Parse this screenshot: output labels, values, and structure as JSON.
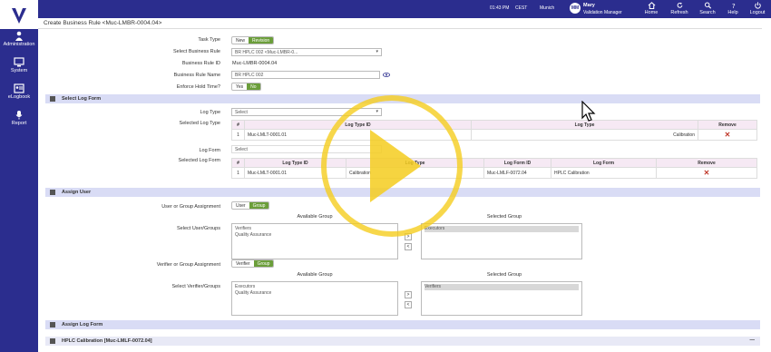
{
  "topbar": {
    "time": "01:43 PM",
    "tz": "CEST",
    "city": "Munich",
    "user_initials": "MM",
    "user_name": "Mary",
    "user_role": "Validation Manager",
    "nav": [
      {
        "label": "Home",
        "icon": "home-icon"
      },
      {
        "label": "Refresh",
        "icon": "refresh-icon"
      },
      {
        "label": "Search",
        "icon": "search-icon"
      },
      {
        "label": "Help",
        "icon": "help-icon"
      },
      {
        "label": "Logout",
        "icon": "power-icon"
      }
    ]
  },
  "sidebar": {
    "items": [
      {
        "label": "Administration",
        "icon": "admin-icon"
      },
      {
        "label": "System",
        "icon": "monitor-icon"
      },
      {
        "label": "eLogbook",
        "icon": "logbook-icon"
      },
      {
        "label": "Report",
        "icon": "report-icon"
      }
    ]
  },
  "page": {
    "title": "Create Business Rule <Muc-LMBR-0004.04>"
  },
  "form": {
    "task_type_label": "Task Type",
    "task_type_opts": [
      "New",
      "Revision"
    ],
    "select_rule_label": "Select Business Rule",
    "select_rule_value": "BR HPLC 002 <Muc-LMBR-0...",
    "rule_id_label": "Business Rule ID",
    "rule_id_value": "Muc-LMBR-0004.04",
    "rule_name_label": "Business Rule Name",
    "rule_name_value": "BR HPLC 002",
    "hold_label": "Enforce Hold Time?",
    "hold_opts": [
      "Yes",
      "No"
    ]
  },
  "log_form_section": {
    "title": "Select Log Form",
    "log_type_label": "Log Type",
    "log_type_value": "Select",
    "sel_log_type_label": "Selected Log Type",
    "lt_headers": [
      "#",
      "Log Type ID",
      "Log Type",
      "Remove"
    ],
    "lt_rows": [
      [
        "1",
        "Muc-LMLT-0001.01",
        "Calibration"
      ]
    ],
    "log_form_label": "Log Form",
    "log_form_value": "Select",
    "sel_log_form_label": "Selected Log Form",
    "lf_headers": [
      "#",
      "Log Type ID",
      "Log Type",
      "Log Form ID",
      "Log Form",
      "Remove"
    ],
    "lf_rows": [
      [
        "1",
        "Muc-LMLT-0001.01",
        "Calibration",
        "Muc-LMLF-0072.04",
        "HPLC Calibration"
      ]
    ]
  },
  "assign_user": {
    "title": "Assign User",
    "ug_label": "User or Group Assignment",
    "ug_opts": [
      "User",
      "Group"
    ],
    "available_hdr": "Available Group",
    "selected_hdr": "Selected Group",
    "sel_users_label": "Select User/Groups",
    "avail_users": [
      "Verifiers",
      "Quality Assurance"
    ],
    "sel_users": [
      "Executors"
    ],
    "vg_label": "Verifier or Group Assignment",
    "vg_opts": [
      "Verifier",
      "Group"
    ],
    "sel_verif_label": "Select Verifier/Groups",
    "avail_verif": [
      "Executors",
      "Quality Assurance"
    ],
    "sel_verif": [
      "Verifiers"
    ],
    "arrows": [
      ">",
      "<"
    ]
  },
  "assign_log": {
    "title": "Assign Log Form",
    "item": "HPLC Calibration [Muc-LMLF-0072.04]",
    "collapse": "—"
  },
  "colors": {
    "brand": "#2b2d8e",
    "section": "#d9dcf5",
    "toggle_on": "#6b9e3a",
    "remove": "#c0392b",
    "play": "#f5cd1e"
  }
}
